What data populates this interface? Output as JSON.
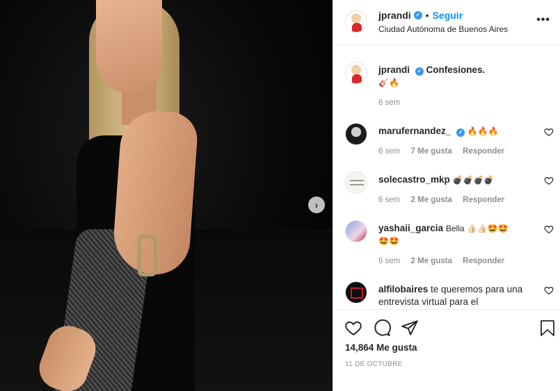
{
  "post": {
    "username": "jprandi",
    "follow_label": "Seguir",
    "separator": "•",
    "location": "Ciudad Autónoma de Buenos Aires",
    "more_label": "•••"
  },
  "caption": {
    "username": "jprandi",
    "text": "Confesiones.",
    "emoji": "🎸🔥",
    "time": "6 sem"
  },
  "comments": [
    {
      "username": "marufernandez_",
      "verified": true,
      "text": "🔥🔥🔥",
      "text2": "",
      "time": "6 sem",
      "likes": "7 Me gusta",
      "reply": "Responder"
    },
    {
      "username": "solecastro_mkp",
      "verified": false,
      "text": "💣💣💣💣",
      "text2": "",
      "time": "6 sem",
      "likes": "2 Me gusta",
      "reply": "Responder"
    },
    {
      "username": "yashaii_garcia",
      "verified": false,
      "text": "Bella 👍🏻👍🏻🤩🤩",
      "text2": "🤩🤩",
      "time": "6 sem",
      "likes": "2 Me gusta",
      "reply": "Responder"
    },
    {
      "username": "alfilobaires",
      "verified": false,
      "text": "te queremos para una entrevista virtual para el",
      "text2": "",
      "time": "",
      "likes": "",
      "reply": ""
    }
  ],
  "footer": {
    "likes": "14,864 Me gusta",
    "date": "11 DE OCTUBRE"
  },
  "icons": [
    "heart-icon",
    "comment-icon",
    "share-icon",
    "bookmark-icon",
    "chevron-right-icon",
    "more-icon",
    "verified-icon"
  ],
  "colors": {
    "accent": "#0095f6",
    "verified": "#3897f0",
    "muted": "#8e8e8e"
  }
}
